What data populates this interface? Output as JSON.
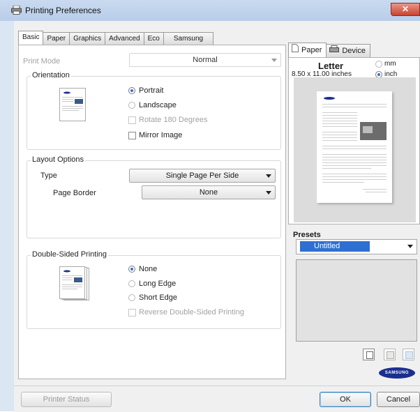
{
  "window": {
    "title": "Printing Preferences",
    "close_label": "✕"
  },
  "tabs": [
    "Basic",
    "Paper",
    "Graphics",
    "Advanced",
    "Eco",
    "Samsung"
  ],
  "basic": {
    "print_mode_label": "Print Mode",
    "print_mode_value": "Normal",
    "orientation": {
      "legend": "Orientation",
      "portrait": "Portrait",
      "landscape": "Landscape",
      "rotate": "Rotate 180 Degrees",
      "mirror": "Mirror Image",
      "selected": "portrait"
    },
    "layout": {
      "legend": "Layout Options",
      "type_label": "Type",
      "type_value": "Single Page Per Side",
      "border_label": "Page Border",
      "border_value": "None"
    },
    "duplex": {
      "legend": "Double-Sided Printing",
      "none": "None",
      "long_edge": "Long Edge",
      "short_edge": "Short Edge",
      "reverse": "Reverse Double-Sided Printing",
      "selected": "none"
    }
  },
  "preview": {
    "tab_paper": "Paper",
    "tab_device": "Device",
    "paper_name": "Letter",
    "paper_size": "8.50 x 11.00 inches",
    "unit_mm": "mm",
    "unit_inch": "inch",
    "unit_selected": "inch"
  },
  "presets": {
    "title": "Presets",
    "selected": "Untitled"
  },
  "brand": {
    "logo_text": "SAMSUNG",
    "brand_color": "#1b2f8f"
  },
  "buttons": {
    "printer_status": "Printer Status",
    "ok": "OK",
    "cancel": "Cancel"
  },
  "colors": {
    "accent": "#2f6fd1",
    "close_button": "#c9432e"
  }
}
